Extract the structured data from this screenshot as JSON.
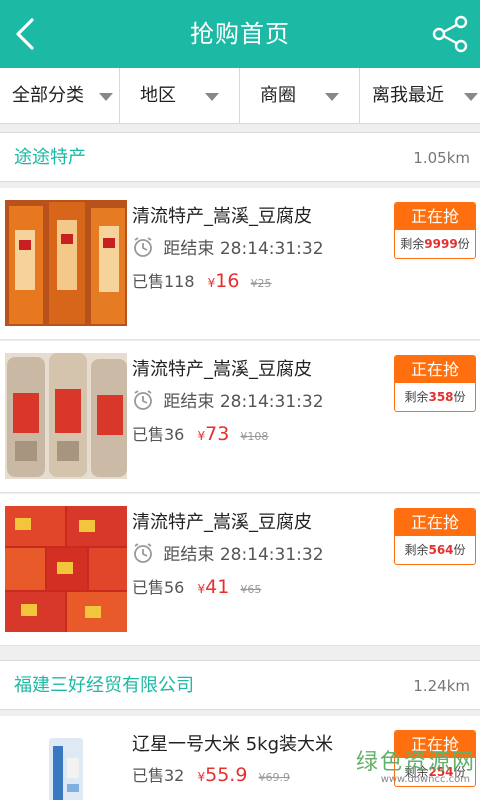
{
  "header": {
    "title": "抢购首页",
    "back_icon": "chevron-left-icon",
    "share_icon": "share-icon"
  },
  "filters": [
    {
      "label": "全部分类"
    },
    {
      "label": "地区"
    },
    {
      "label": "商圈"
    },
    {
      "label": "离我最近"
    }
  ],
  "sections": [
    {
      "shop": "途途特产",
      "distance": "1.05km",
      "items": [
        {
          "name": "清流特产_嵩溪_豆腐皮",
          "timer_label": "距结束",
          "timer": "28:14:31:32",
          "sold": "已售118",
          "currency": "¥",
          "price": "16",
          "original": "¥25",
          "status": "正在抢",
          "remaining_prefix": "剩余",
          "remaining": "9999",
          "remaining_unit": "份"
        },
        {
          "name": "清流特产_嵩溪_豆腐皮",
          "timer_label": "距结束",
          "timer": "28:14:31:32",
          "sold": "已售36",
          "currency": "¥",
          "price": "73",
          "original": "¥108",
          "status": "正在抢",
          "remaining_prefix": "剩余",
          "remaining": "358",
          "remaining_unit": "份"
        },
        {
          "name": "清流特产_嵩溪_豆腐皮",
          "timer_label": "距结束",
          "timer": "28:14:31:32",
          "sold": "已售56",
          "currency": "¥",
          "price": "41",
          "original": "¥65",
          "status": "正在抢",
          "remaining_prefix": "剩余",
          "remaining": "564",
          "remaining_unit": "份"
        }
      ]
    },
    {
      "shop": "福建三好经贸有限公司",
      "distance": "1.24km",
      "items": [
        {
          "name": "辽星一号大米 5kg装大米",
          "sold": "已售32",
          "currency": "¥",
          "price": "55.9",
          "original": "¥69.9",
          "status": "正在抢",
          "remaining_prefix": "剩余",
          "remaining": "254",
          "remaining_unit": "份"
        }
      ]
    }
  ],
  "watermark": {
    "text": "绿色资源网",
    "url": "www.downcc.com"
  },
  "colors": {
    "header": "#1cb9a4",
    "accent_orange": "#ff6f0f",
    "price_red": "#e63030"
  }
}
